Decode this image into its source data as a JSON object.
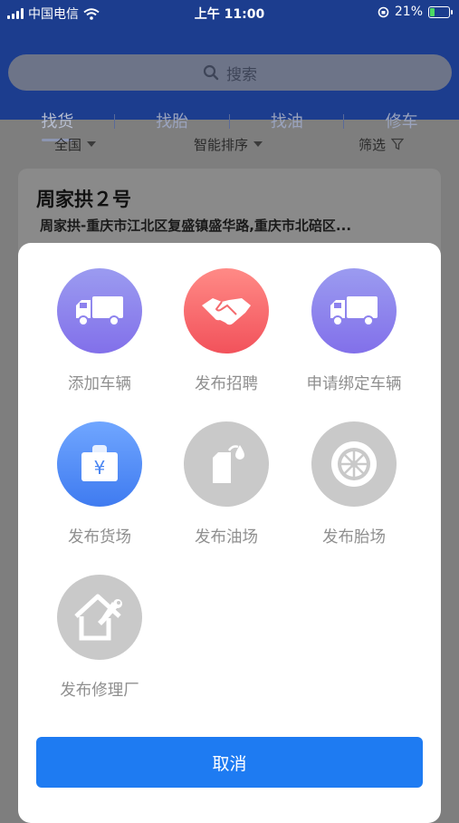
{
  "status_bar": {
    "carrier": "中国电信",
    "time": "上午 11:00",
    "battery": "21%"
  },
  "search": {
    "placeholder": "搜索"
  },
  "tabs": [
    {
      "label": "找货",
      "active": true
    },
    {
      "label": "找胎",
      "active": false
    },
    {
      "label": "找油",
      "active": false
    },
    {
      "label": "修车",
      "active": false
    }
  ],
  "filters": {
    "region": "全国",
    "sort": "智能排序",
    "filter": "筛选"
  },
  "listing": {
    "title": "周家拱２号",
    "address": "周家拱-重庆市江北区复盛镇盛华路,重庆市北碚区..."
  },
  "action_sheet": {
    "actions": [
      {
        "label": "添加车辆",
        "icon": "truck-icon",
        "color": "purple"
      },
      {
        "label": "发布招聘",
        "icon": "handshake-icon",
        "color": "red"
      },
      {
        "label": "申请绑定车辆",
        "icon": "truck-icon",
        "color": "purple"
      },
      {
        "label": "发布货场",
        "icon": "yuan-bag-icon",
        "color": "blue"
      },
      {
        "label": "发布油场",
        "icon": "oil-can-icon",
        "color": "gray"
      },
      {
        "label": "发布胎场",
        "icon": "tire-icon",
        "color": "gray"
      },
      {
        "label": "发布修理厂",
        "icon": "repair-house-icon",
        "color": "gray"
      }
    ],
    "cancel_label": "取消"
  }
}
